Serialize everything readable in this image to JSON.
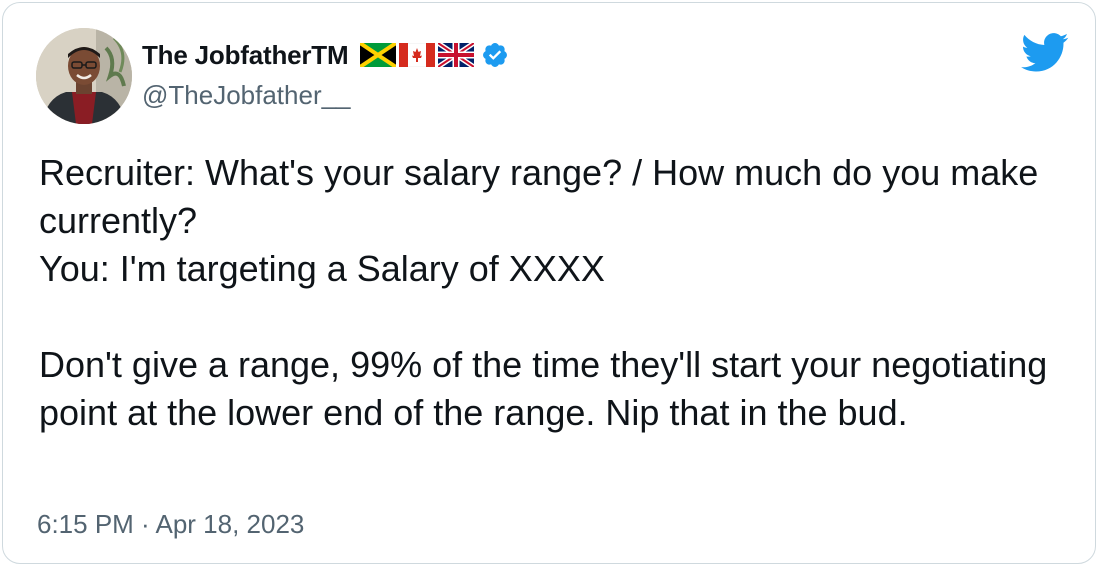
{
  "author": {
    "display_name": "The JobfatherTM",
    "handle": "@TheJobfather__",
    "flag_icons": [
      "jamaica-flag-icon",
      "canada-flag-icon",
      "uk-flag-icon"
    ],
    "verified_icon": "verified-badge-icon",
    "verified_color": "#1d9bf0"
  },
  "brand": {
    "logo_icon": "twitter-bird-icon",
    "logo_color": "#1d9bf0"
  },
  "tweet": {
    "line1": "Recruiter: What's your salary range? / How much do you make currently?",
    "line2": "You: I'm targeting a Salary of XXXX",
    "line3": "Don't give a range, 99% of the time they'll start your negotiating point at the lower end of the range. Nip that in the bud."
  },
  "timestamp": "6:15 PM · Apr 18, 2023",
  "colors": {
    "text": "#0f1419",
    "secondary_text": "#536471",
    "border": "#cfd9de"
  }
}
